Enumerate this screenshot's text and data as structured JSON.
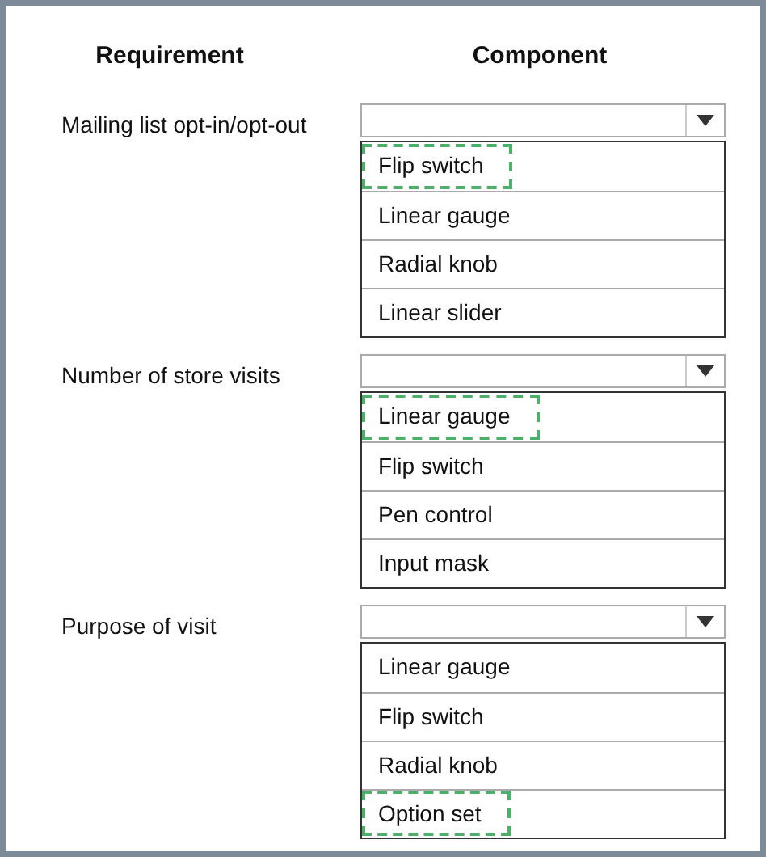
{
  "headers": [
    "Requirement",
    "Component"
  ],
  "requirements": [
    {
      "label": "Mailing list opt-in/opt-out",
      "options": [
        {
          "label": "Flip switch",
          "selected": true
        },
        {
          "label": "Linear gauge",
          "selected": false
        },
        {
          "label": "Radial knob",
          "selected": false
        },
        {
          "label": "Linear slider",
          "selected": false
        }
      ]
    },
    {
      "label": "Number of store visits",
      "options": [
        {
          "label": "Linear gauge",
          "selected": true
        },
        {
          "label": "Flip switch",
          "selected": false
        },
        {
          "label": "Pen control",
          "selected": false
        },
        {
          "label": "Input mask",
          "selected": false
        }
      ]
    },
    {
      "label": "Purpose of visit",
      "options": [
        {
          "label": "Linear gauge",
          "selected": false
        },
        {
          "label": "Flip switch",
          "selected": false
        },
        {
          "label": "Radial knob",
          "selected": false
        },
        {
          "label": "Option set",
          "selected": true
        }
      ]
    }
  ]
}
